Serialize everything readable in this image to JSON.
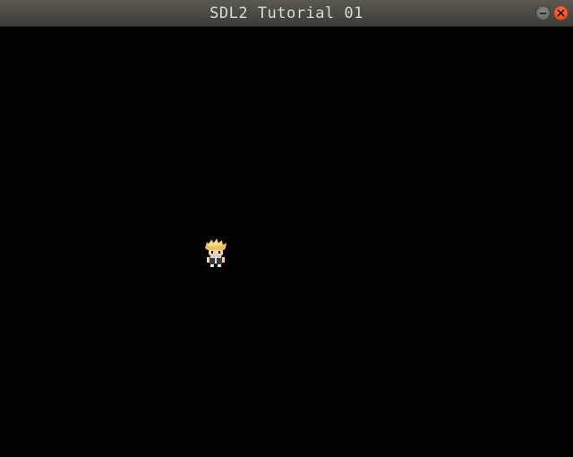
{
  "window": {
    "title": "SDL2 Tutorial 01",
    "background_color": "#000000"
  },
  "titlebar": {
    "buttons": [
      {
        "name": "minimize",
        "icon": "minimize-icon"
      },
      {
        "name": "close",
        "icon": "close-icon"
      }
    ]
  },
  "canvas": {
    "sprite": {
      "icon": "character-sprite"
    }
  }
}
